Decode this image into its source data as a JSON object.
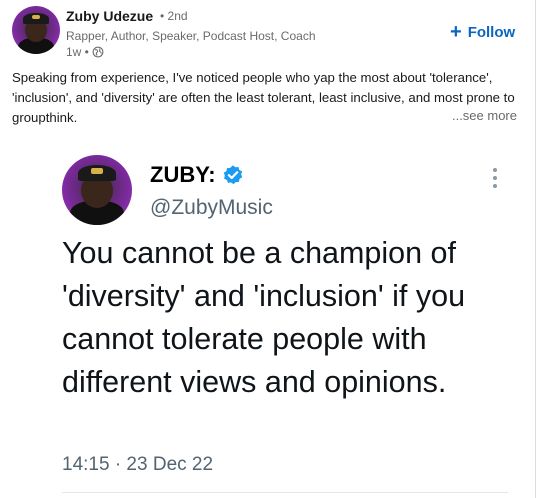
{
  "post": {
    "author_name": "Zuby Udezue",
    "degree": "• 2nd",
    "headline": "Rapper, Author, Speaker, Podcast Host, Coach",
    "timestamp": "1w •",
    "follow_label": "Follow",
    "text": "Speaking from experience, I've noticed people who yap the most about 'tolerance', 'inclusion', and 'diversity' are often the least tolerant, least inclusive, and most prone to groupthink.",
    "see_more_label": "...see more"
  },
  "tweet": {
    "name": "ZUBY:",
    "handle": "@ZubyMusic",
    "text": "You cannot be a champion of 'diversity' and 'inclusion' if you cannot tolerate people with different views and opinions.",
    "time": "14:15 · 23 Dec 22"
  },
  "colors": {
    "accent": "#0a66c2",
    "verified": "#1d9bf0",
    "avatar_bg": "#8a2fb8"
  },
  "icons": [
    "globe-icon",
    "plus-icon",
    "verified-icon",
    "more-icon"
  ]
}
